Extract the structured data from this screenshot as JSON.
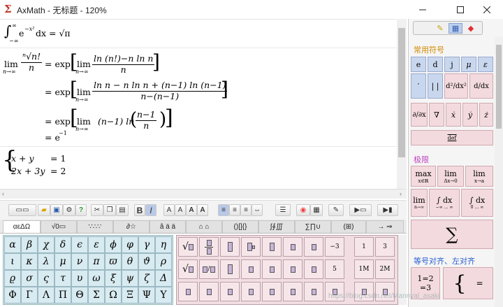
{
  "window": {
    "title": "AxMath - 无标题 - 120%",
    "app_icon": "Σ",
    "minimize_icon": "minimize-icon",
    "maximize_icon": "maximize-icon",
    "close_icon": "close-icon"
  },
  "editor": {
    "eq1": {
      "lhs_sup": "∞",
      "lhs_sub": "−∞",
      "body": "e",
      "exp": "−x²",
      "dx": "dx",
      "rhs": "= √π"
    },
    "eq2": {
      "lim": "lim",
      "lim_sub": "n→∞",
      "lhs_num": "ⁿ√n!",
      "lhs_den": "n",
      "l1_exp": "= exp",
      "l1_num": "ln (n!)−n ln n",
      "l1_den": "n",
      "l2_num": "ln n − n ln n + (n−1) ln (n−1)",
      "l2_den": "n−(n−1)",
      "l3_body": "(n−1) ln",
      "l3_num": "n−1",
      "l3_den": "n",
      "l4": "= e",
      "l4_exp": "−1"
    },
    "eq3": {
      "r1_lhs": "x + y",
      "r1_rhs": "=  1",
      "r2_lhs": "2x + 3y",
      "r2_rhs": "=  2"
    }
  },
  "toolbar": {
    "bold_label": "B",
    "italic_label": "I",
    "font_btn_labels": [
      "A",
      "A",
      "A",
      "A"
    ]
  },
  "symbol_tabs": [
    "αεΔΩ",
    "√0▭",
    "∵∴∵",
    "∂☆",
    "â ä ä",
    "⌂ ⌂",
    "()[]{}",
    "∫∮∭",
    "∑∏∪",
    "(⊞)",
    "→ ⇒"
  ],
  "greek": {
    "row1": [
      "α",
      "β",
      "χ",
      "δ",
      "ϵ",
      "ε",
      "ϕ",
      "φ",
      "γ",
      "η"
    ],
    "row2": [
      "ι",
      "κ",
      "λ",
      "μ",
      "ν",
      "π",
      "ϖ",
      "θ",
      "ϑ",
      "ρ"
    ],
    "row3": [
      "ϱ",
      "σ",
      "ς",
      "τ",
      "υ",
      "ω",
      "ξ",
      "ψ",
      "ζ",
      "Δ"
    ],
    "row4": [
      "Φ",
      "Γ",
      "Λ",
      "Π",
      "Θ",
      "Σ",
      "Ω",
      "Ξ",
      "Ψ",
      "Υ"
    ]
  },
  "templates": {
    "labels": [
      "−3",
      "1",
      "3",
      "5",
      "1M",
      "2M"
    ]
  },
  "sidebar": {
    "section_common": "常用符号",
    "common_row1": [
      "e",
      "d",
      "j",
      "μ",
      "ε"
    ],
    "common_row2": [
      "′",
      "| |",
      "d²/dx²",
      "d/dx"
    ],
    "common_row3": [
      "∂/∂x",
      "∇",
      "ẋ",
      "ẏ",
      "ż"
    ],
    "common_row4": "def",
    "section_limit": "极限",
    "limit_row1": [
      "max",
      "lim",
      "lim"
    ],
    "limit_row1_sub": [
      "x∈ℝ",
      "Δx→0",
      "x→a"
    ],
    "limit_row2": [
      "lim",
      "∫ dx",
      "∫ dx"
    ],
    "limit_row2_sub": [
      "n→∞",
      "−∞ … ∞",
      "0 … ∞"
    ],
    "limit_row3": "∑",
    "section_align": "等号对齐、左对齐",
    "align_cells": [
      "1=2",
      "="
    ],
    "align_cells_2": [
      "=3"
    ]
  },
  "watermark": "https://blog.csdn.net/Mannyal_asaki"
}
